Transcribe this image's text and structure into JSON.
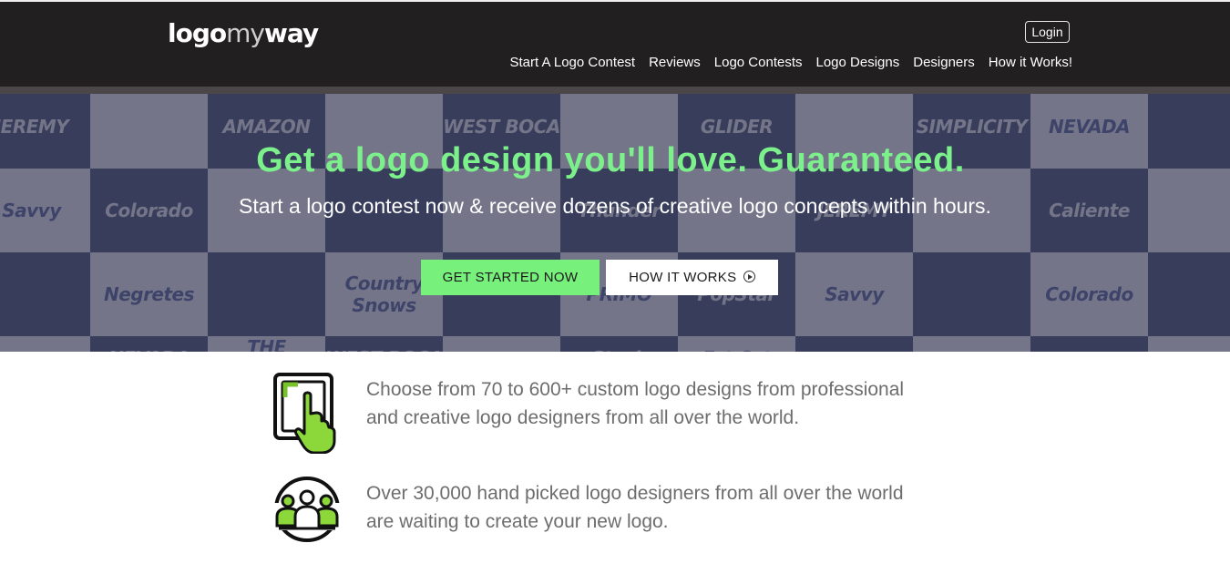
{
  "header": {
    "logo": {
      "part1": "logo",
      "part2": "my",
      "part3": "way"
    },
    "login_label": "Login",
    "nav": [
      "Start A Logo Contest",
      "Reviews",
      "Logo Contests",
      "Logo Designs",
      "Designers",
      "How it Works!"
    ]
  },
  "hero": {
    "title": "Get a logo design you'll love. Guaranteed.",
    "subtitle": "Start a logo contest now & receive dozens of creative logo concepts within hours.",
    "cta_primary": "GET STARTED NOW",
    "cta_secondary": "HOW IT WORKS",
    "background_tiles": [
      "JEREMY",
      "",
      "AMAZON",
      "",
      "WEST BOCA",
      "",
      "GLIDER",
      "",
      "SIMPLICITY",
      "NEVADA",
      "",
      "Savvy",
      "Colorado",
      "",
      "",
      "",
      "Thunder",
      "",
      "JEREMY",
      "",
      "Caliente",
      "",
      "",
      "Negretes",
      "",
      "Country Snows",
      "",
      "PRIMO",
      "PopStar",
      "Savvy",
      "",
      "Colorado",
      "",
      "",
      "NEVADA",
      "THE AIRPORT",
      "WEST BOCA",
      "",
      "Stash",
      "Fat Cat",
      "",
      "",
      "",
      ""
    ]
  },
  "features": [
    {
      "icon": "touch-screen-icon",
      "text_line1": "Choose from 70 to 600+ custom logo designs from professional",
      "text_line2": "and creative logo designers from all over the world."
    },
    {
      "icon": "designers-group-icon",
      "text_line1": "Over 30,000 hand picked logo designers from all over the world",
      "text_line2": "are waiting to create your new logo."
    }
  ],
  "colors": {
    "header_bg": "#221f20",
    "accent_green": "#78f07c",
    "title_green": "#7cf18b",
    "body_text": "#6d6d6d"
  }
}
